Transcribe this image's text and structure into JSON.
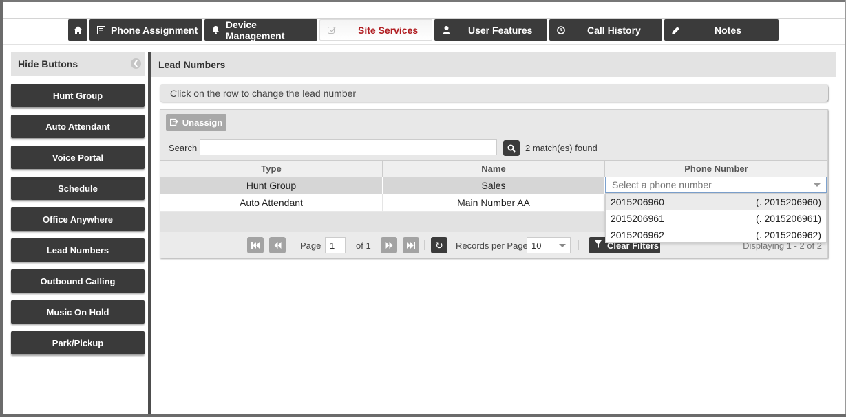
{
  "tabs": [
    {
      "label": "",
      "icon": "home-icon"
    },
    {
      "label": "Phone Assignment",
      "icon": "list-icon"
    },
    {
      "label": "Device Management",
      "icon": "bell-icon"
    },
    {
      "label": "Site Services",
      "icon": "edit-icon",
      "active": true
    },
    {
      "label": "User Features",
      "icon": "user-icon"
    },
    {
      "label": "Call History",
      "icon": "clock-icon"
    },
    {
      "label": "Notes",
      "icon": "pencil-icon"
    }
  ],
  "sidebar": {
    "title": "Hide Buttons",
    "items": [
      "Hunt Group",
      "Auto Attendant",
      "Voice Portal",
      "Schedule",
      "Office Anywhere",
      "Lead Numbers",
      "Outbound Calling",
      "Music On Hold",
      "Park/Pickup"
    ]
  },
  "main": {
    "title": "Lead Numbers",
    "info": "Click on the row to change the lead number",
    "unassign_label": "Unassign",
    "search_label": "Search",
    "search_value": "",
    "matches": "2 match(es) found",
    "columns": [
      "Type",
      "Name",
      "Phone Number"
    ],
    "rows": [
      {
        "type": "Hunt Group",
        "name": "Sales",
        "phone": ""
      },
      {
        "type": "Auto Attendant",
        "name": "Main Number AA",
        "phone": ""
      }
    ],
    "phone_select": {
      "placeholder": "Select a phone number",
      "options": [
        {
          "number": "2015206960",
          "label": "(. 2015206960)"
        },
        {
          "number": "2015206961",
          "label": "(. 2015206961)"
        },
        {
          "number": "2015206962",
          "label": "(. 2015206962)"
        }
      ]
    },
    "pager": {
      "page_label": "Page",
      "page_value": "1",
      "of_label": "of 1",
      "rpp_label": "Records per Page",
      "rpp_value": "10",
      "clear_filters": "Clear Filters",
      "displaying": "Displaying 1 - 2 of 2"
    }
  }
}
